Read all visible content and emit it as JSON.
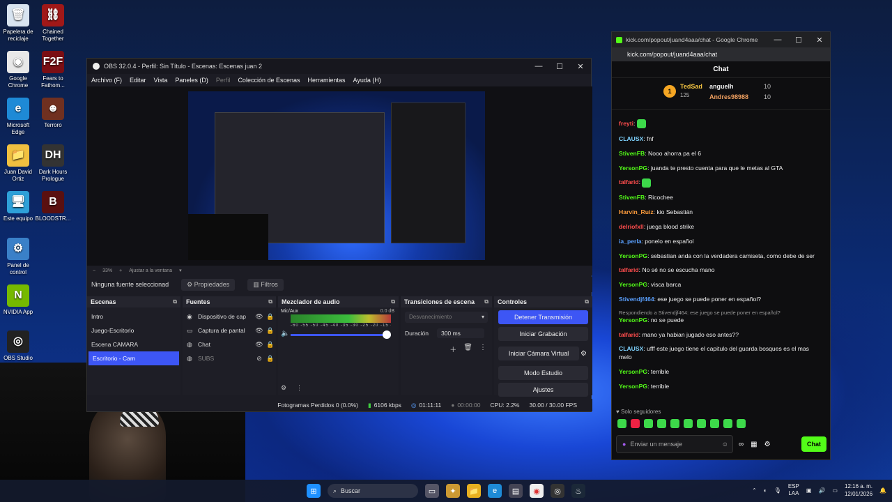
{
  "desktop": {
    "icons": [
      {
        "label": "Papelera de reciclaje",
        "color": "#d8e4f0",
        "glyph": "🗑"
      },
      {
        "label": "Chained Together",
        "color": "#a01818",
        "glyph": "⛓"
      },
      {
        "label": "Google Chrome",
        "color": "#e8e8e8",
        "glyph": "◉"
      },
      {
        "label": "Fears to Fathom...",
        "color": "#7a0e14",
        "glyph": "F2F"
      },
      {
        "label": "Microsoft Edge",
        "color": "#1e8ad6",
        "glyph": "e"
      },
      {
        "label": "Terroro",
        "color": "#703020",
        "glyph": "☻"
      },
      {
        "label": "Juan David Ortiz",
        "color": "#f0c040",
        "glyph": "📁"
      },
      {
        "label": "Dark Hours Prologue",
        "color": "#333333",
        "glyph": "DH"
      },
      {
        "label": "Este equipo",
        "color": "#2ea0d8",
        "glyph": "🖥"
      },
      {
        "label": "BLOODSTR...",
        "color": "#5a1010",
        "glyph": "B"
      },
      {
        "label": "Panel de control",
        "color": "#3a80c8",
        "glyph": "⚙"
      },
      {
        "label": "NVIDIA App",
        "color": "#76b900",
        "glyph": "N"
      },
      {
        "label": "OBS Studio",
        "color": "#222222",
        "glyph": "◎"
      }
    ]
  },
  "obs": {
    "title": "OBS 32.0.4 - Perfil: Sin Título - Escenas: Escenas juan 2",
    "menu": [
      "Archivo (F)",
      "Editar",
      "Vista",
      "Paneles (D)",
      "Perfil",
      "Colección de Escenas",
      "Herramientas",
      "Ayuda (H)"
    ],
    "zoom": {
      "minus": "−",
      "value": "33%",
      "plus": "+",
      "fit": "Ajustar a la ventana"
    },
    "source_bar": {
      "none": "Ninguna fuente seleccionad",
      "properties": "Propiedades",
      "filters": "Filtros"
    },
    "scenes": {
      "title": "Escenas",
      "items": [
        "Intro",
        "Juego-Escritorio",
        "Escena CAMARA",
        "Escritorio - Cam"
      ],
      "selected_index": 3
    },
    "sources": {
      "title": "Fuentes",
      "items": [
        {
          "label": "Dispositivo de cap",
          "icon": "camera-icon"
        },
        {
          "label": "Captura de pantal",
          "icon": "monitor-icon"
        },
        {
          "label": "Chat",
          "icon": "browser-icon"
        },
        {
          "label": "SUBS",
          "icon": "browser-icon"
        }
      ]
    },
    "audio": {
      "title": "Mezclador de audio",
      "channel": "Mic/Aux",
      "db": "0.0 dB",
      "scale": "-60 -55 -50 -45 -40 -35 -30 -25 -20 -15 -10 -5 0"
    },
    "transitions": {
      "title": "Transiciones de escena",
      "selected": "Desvanecimiento",
      "duration_label": "Duración",
      "duration_value": "300 ms"
    },
    "controls": {
      "title": "Controles",
      "buttons": [
        "Detener Transmisión",
        "Iniciar Grabación",
        "Iniciar Cámara Virtual",
        "Modo Estudio",
        "Ajustes"
      ]
    },
    "status": {
      "dropped": "Fotogramas Perdidos 0 (0.0%)",
      "bitrate": "6106 kbps",
      "stream_time": "01:11:11",
      "rec_time": "00:00:00",
      "cpu": "CPU: 2.2%",
      "fps": "30.00 / 30.00 FPS"
    }
  },
  "chrome": {
    "title": "kick.com/popout/juand4aaa/chat - Google Chrome",
    "url": "kick.com/popout/juand4aaa/chat",
    "chat_title": "Chat",
    "leaderboard": [
      {
        "name": "TedSad",
        "value": "125"
      },
      {
        "name": "anguelh",
        "value": "10"
      },
      {
        "name": "Andres98988",
        "value": "10"
      }
    ],
    "messages": [
      {
        "user": "freyti",
        "color": "#ff4d4d",
        "text": ""
      },
      {
        "user": "CLAUSX",
        "color": "#7fd3ff",
        "text": "fnf"
      },
      {
        "user": "StivenFB",
        "color": "#53fc18",
        "text": "Nooo ahorra pa el 6"
      },
      {
        "user": "YersonPG",
        "color": "#53fc18",
        "text": "juanda te presto cuenta para que le metas al GTA"
      },
      {
        "user": "talfarid",
        "color": "#ff4d4d",
        "text": ""
      },
      {
        "user": "StivenFB",
        "color": "#53fc18",
        "text": "Ricochee"
      },
      {
        "user": "Harvin_Ruiz",
        "color": "#ff9d3c",
        "text": "kio Sebastián"
      },
      {
        "user": "delriofxll",
        "color": "#ff4d4d",
        "text": "juega blood strike"
      },
      {
        "user": "ia_perla",
        "color": "#5aa0ff",
        "text": "ponelo en español"
      },
      {
        "user": "YersonPG",
        "color": "#53fc18",
        "text": "sebastian anda con la verdadera camiseta, como debe de ser"
      },
      {
        "user": "talfarid",
        "color": "#ff4d4d",
        "text": "No sé no se escucha mano"
      },
      {
        "user": "YersonPG",
        "color": "#53fc18",
        "text": "visca barca"
      },
      {
        "user": "Stivendjf464",
        "color": "#5aa0ff",
        "text": "ese juego se puede poner en español?"
      },
      {
        "user": "YersonPG",
        "color": "#53fc18",
        "text": "no se puede",
        "reply": "Respondiendo a Stivendjf464: ese juego se puede poner en español?"
      },
      {
        "user": "talfarid",
        "color": "#ff4d4d",
        "text": "mano ya habian jugado eso antes??"
      },
      {
        "user": "CLAUSX",
        "color": "#7fd3ff",
        "text": "ufff este juego tiene el capitulo del guarda bosques es el mas melo"
      },
      {
        "user": "YersonPG",
        "color": "#53fc18",
        "text": "terrible"
      },
      {
        "user": "YersonPG",
        "color": "#53fc18",
        "text": "terrible"
      }
    ],
    "followers_only": "Solo seguidores",
    "input_placeholder": "Enviar un mensaje",
    "send_label": "Chat"
  },
  "taskbar": {
    "search": "Buscar",
    "lang": "ESP",
    "lang2": "LAA",
    "time": "12:16 a. m.",
    "date": "12/01/2026"
  }
}
